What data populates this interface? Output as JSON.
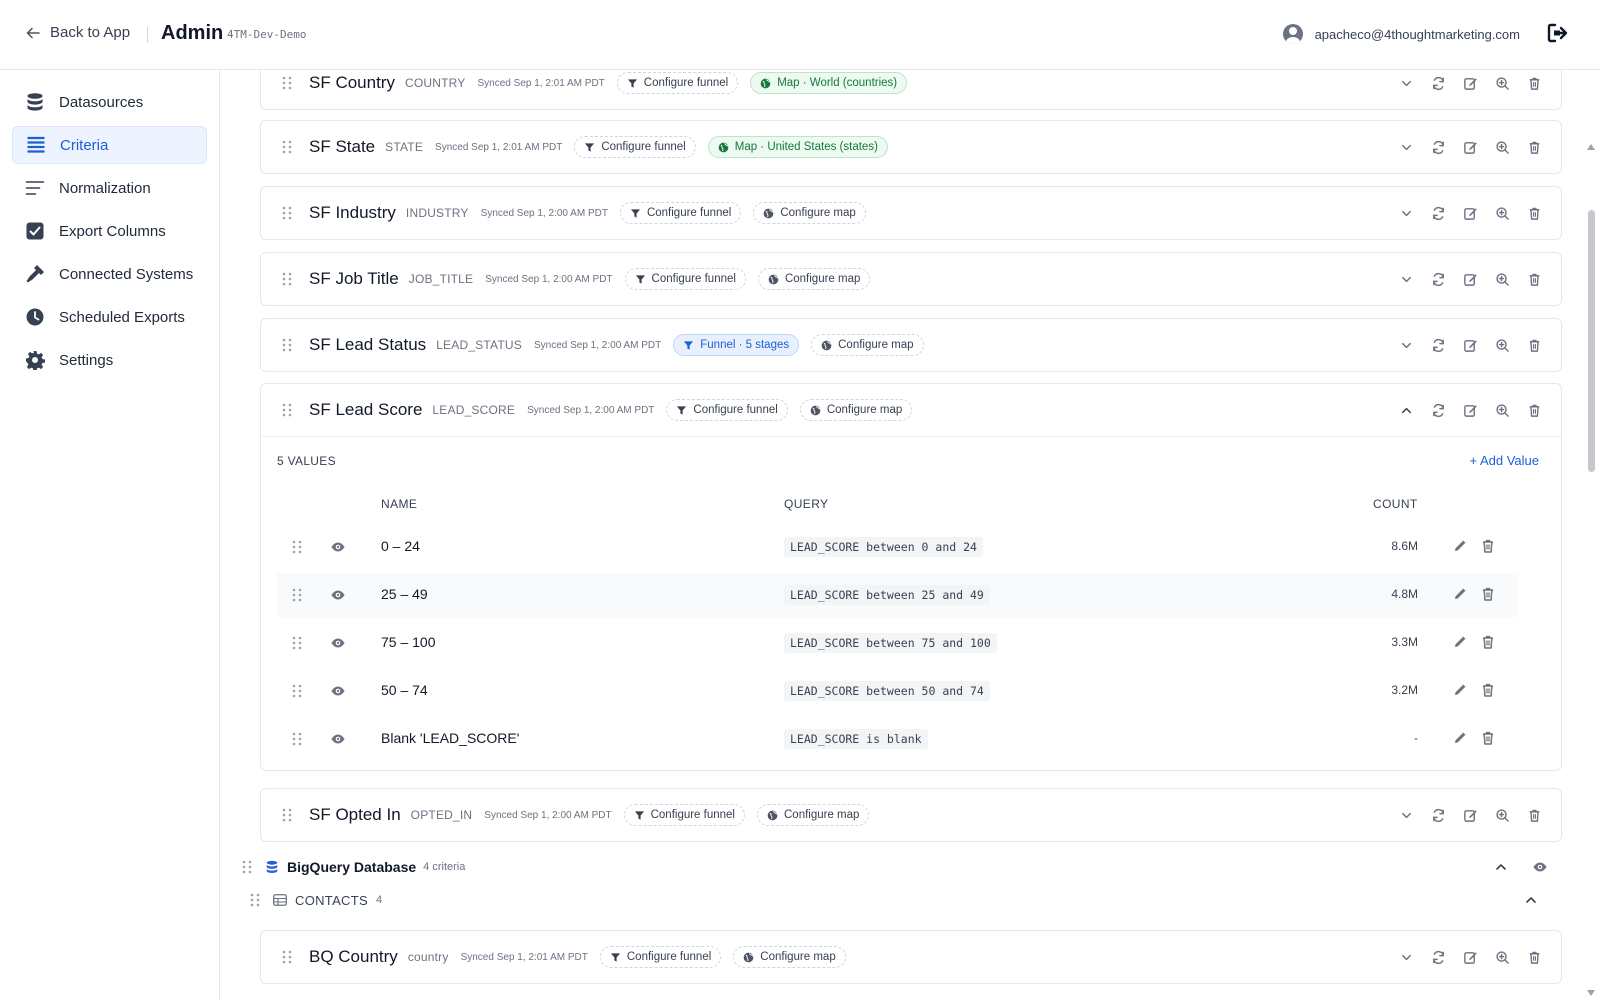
{
  "topbar": {
    "back_label": "Back to App",
    "title": "Admin",
    "tenant": "4TM-Dev-Demo",
    "user_email": "apacheco@4thoughtmarketing.com"
  },
  "sidebar": {
    "items": [
      {
        "label": "Datasources",
        "icon": "database-icon"
      },
      {
        "label": "Criteria",
        "icon": "list-icon",
        "active": true
      },
      {
        "label": "Normalization",
        "icon": "lines-icon"
      },
      {
        "label": "Export Columns",
        "icon": "checkbox-icon"
      },
      {
        "label": "Connected Systems",
        "icon": "plug-icon"
      },
      {
        "label": "Scheduled Exports",
        "icon": "clock-icon"
      },
      {
        "label": "Settings",
        "icon": "gear-icon"
      }
    ]
  },
  "criteria": [
    {
      "name": "SF Country",
      "field": "COUNTRY",
      "synced": "Synced Sep 1, 2:01 AM PDT",
      "funnel": "Configure funnel",
      "map": "Map · World (countries)",
      "map_state": "green",
      "funnel_state": "dashed"
    },
    {
      "name": "SF State",
      "field": "STATE",
      "synced": "Synced Sep 1, 2:01 AM PDT",
      "funnel": "Configure funnel",
      "map": "Map · United States (states)",
      "map_state": "green",
      "funnel_state": "dashed"
    },
    {
      "name": "SF Industry",
      "field": "INDUSTRY",
      "synced": "Synced Sep 1, 2:00 AM PDT",
      "funnel": "Configure funnel",
      "map": "Configure map",
      "map_state": "dashed",
      "funnel_state": "dashed"
    },
    {
      "name": "SF Job Title",
      "field": "JOB_TITLE",
      "synced": "Synced Sep 1, 2:00 AM PDT",
      "funnel": "Configure funnel",
      "map": "Configure map",
      "map_state": "dashed",
      "funnel_state": "dashed"
    },
    {
      "name": "SF Lead Status",
      "field": "LEAD_STATUS",
      "synced": "Synced Sep 1, 2:00 AM PDT",
      "funnel": "Funnel · 5 stages",
      "map": "Configure map",
      "map_state": "dashed",
      "funnel_state": "blue"
    },
    {
      "name": "SF Lead Score",
      "field": "LEAD_SCORE",
      "synced": "Synced Sep 1, 2:00 AM PDT",
      "funnel": "Configure funnel",
      "map": "Configure map",
      "map_state": "dashed",
      "funnel_state": "dashed",
      "expanded": true
    },
    {
      "name": "SF Opted In",
      "field": "OPTED_IN",
      "synced": "Synced Sep 1, 2:00 AM PDT",
      "funnel": "Configure funnel",
      "map": "Configure map",
      "map_state": "dashed",
      "funnel_state": "dashed"
    }
  ],
  "lead_score": {
    "values_count_label": "5 VALUES",
    "add_value_label": "+ Add Value",
    "columns": {
      "name": "NAME",
      "query": "QUERY",
      "count": "COUNT"
    },
    "rows": [
      {
        "name": "0 – 24",
        "query": "LEAD_SCORE between 0 and 24",
        "count": "8.6M"
      },
      {
        "name": "25 – 49",
        "query": "LEAD_SCORE between 25 and 49",
        "count": "4.8M"
      },
      {
        "name": "75 – 100",
        "query": "LEAD_SCORE between 75 and 100",
        "count": "3.3M"
      },
      {
        "name": "50 – 74",
        "query": "LEAD_SCORE between 50 and 74",
        "count": "3.2M"
      },
      {
        "name": "Blank 'LEAD_SCORE'",
        "query": "LEAD_SCORE is blank",
        "count": "-"
      }
    ]
  },
  "bigquery": {
    "name": "BigQuery Database",
    "count": "4 criteria",
    "table_name": "CONTACTS",
    "table_count": "4",
    "first_criterion": {
      "name": "BQ Country",
      "field": "country",
      "synced": "Synced Sep 1, 2:01 AM PDT",
      "funnel": "Configure funnel",
      "map": "Configure map"
    }
  },
  "colors": {
    "accent": "#1d5fd6",
    "active_bg": "#eef4ff",
    "green_chip": "#137a3f"
  }
}
